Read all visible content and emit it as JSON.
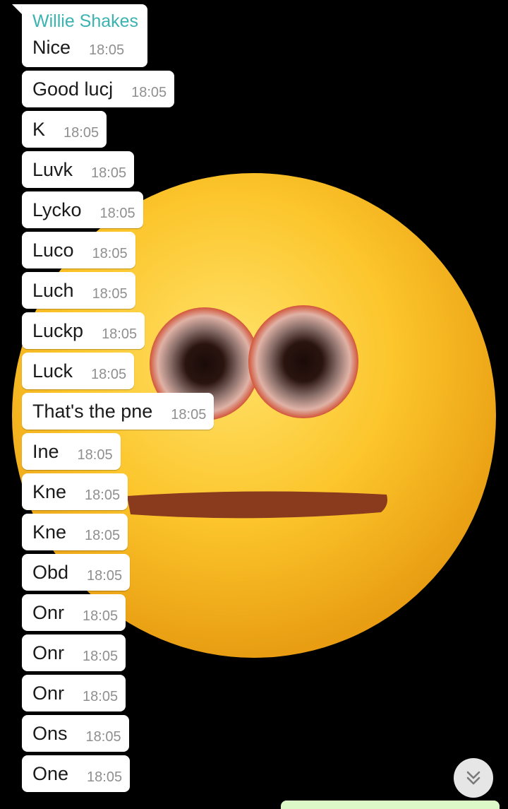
{
  "chat": {
    "sender": "Willie Shakes",
    "sender_color": "#3bb3b0",
    "messages": [
      {
        "text": "Nice",
        "time": "18:05"
      },
      {
        "text": "Good lucj",
        "time": "18:05"
      },
      {
        "text": "K",
        "time": "18:05"
      },
      {
        "text": "Luvk",
        "time": "18:05"
      },
      {
        "text": "Lycko",
        "time": "18:05"
      },
      {
        "text": "Luco",
        "time": "18:05"
      },
      {
        "text": "Luch",
        "time": "18:05"
      },
      {
        "text": "Luckp",
        "time": "18:05"
      },
      {
        "text": "Luck",
        "time": "18:05"
      },
      {
        "text": "That's the pne",
        "time": "18:05"
      },
      {
        "text": "Ine",
        "time": "18:05"
      },
      {
        "text": "Kne",
        "time": "18:05"
      },
      {
        "text": "Kne",
        "time": "18:05"
      },
      {
        "text": "Obd",
        "time": "18:05"
      },
      {
        "text": "Onr",
        "time": "18:05"
      },
      {
        "text": "Onr",
        "time": "18:05"
      },
      {
        "text": "Onr",
        "time": "18:05"
      },
      {
        "text": "Ons",
        "time": "18:05"
      },
      {
        "text": "One",
        "time": "18:05"
      }
    ]
  },
  "controls": {
    "scroll_down_icon": "double-chevron-down-icon"
  },
  "colors": {
    "wallpaper_background": "#000000",
    "incoming_bubble": "#ffffff",
    "outgoing_bubble": "#dcf8c6"
  }
}
